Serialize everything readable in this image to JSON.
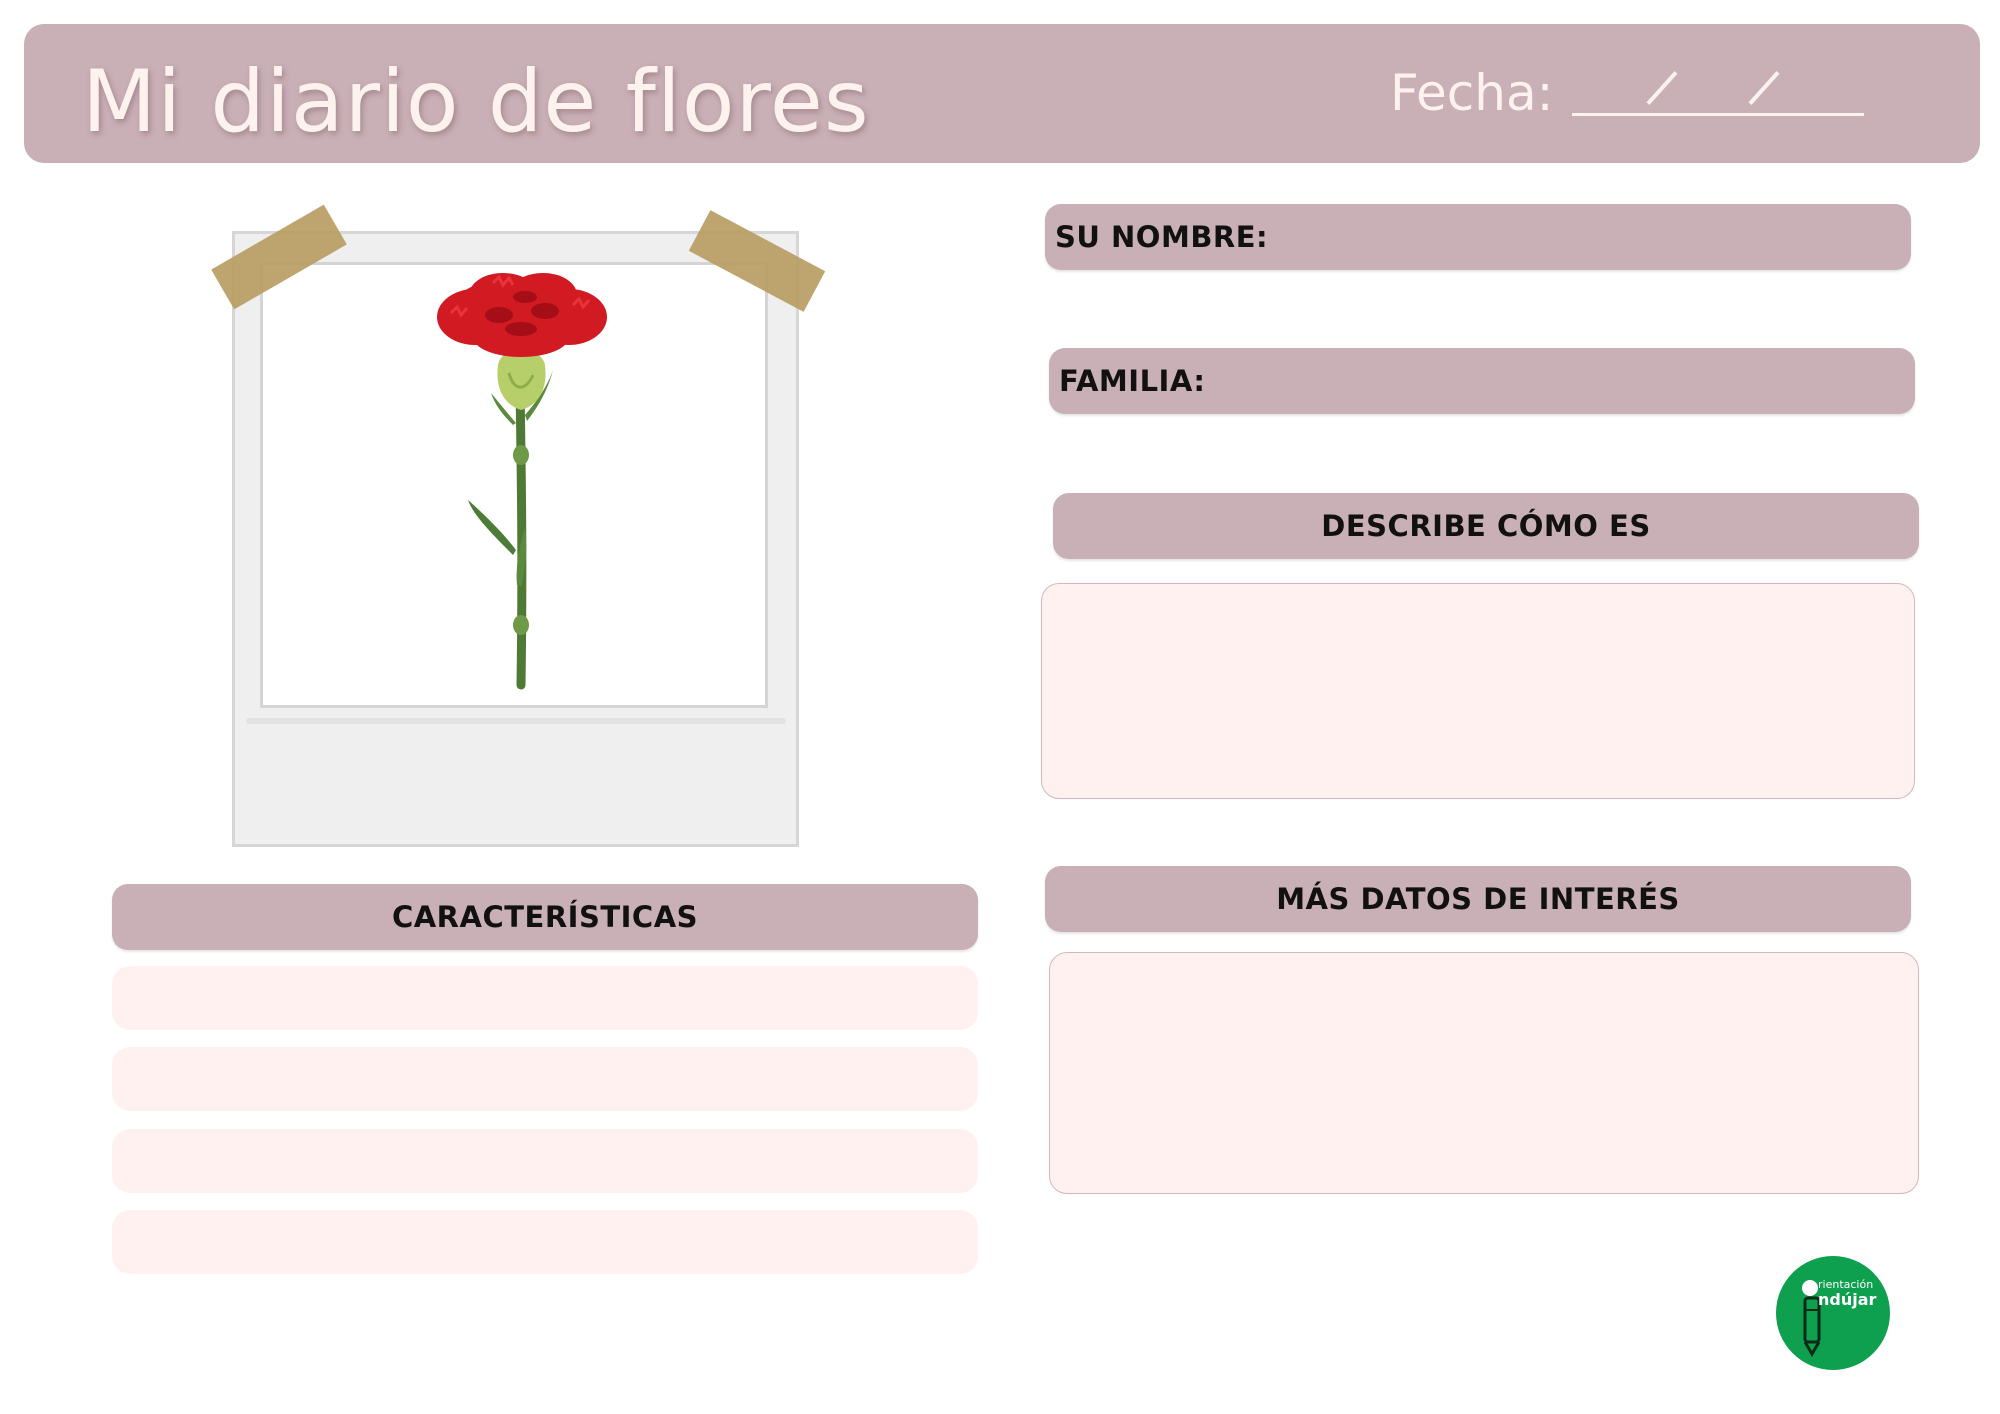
{
  "header": {
    "title": "Mi diario de flores",
    "date_label": "Fecha:"
  },
  "fields": {
    "name_label": "SU NOMBRE:",
    "family_label": "FAMILIA:",
    "describe_label": "DESCRIBE CÓMO ES",
    "more_label": "MÁS DATOS DE INTERÉS",
    "characteristics_label": "CARACTERÍSTICAS"
  },
  "photo": {
    "subject": "red carnation flower"
  },
  "logo": {
    "line1": "rientación",
    "line2": "ndújar",
    "brand_color": "#0ea04f"
  },
  "colors": {
    "accent": "#c9afb6",
    "fill": "#fff1ef",
    "header_text": "#fdf2ee"
  }
}
